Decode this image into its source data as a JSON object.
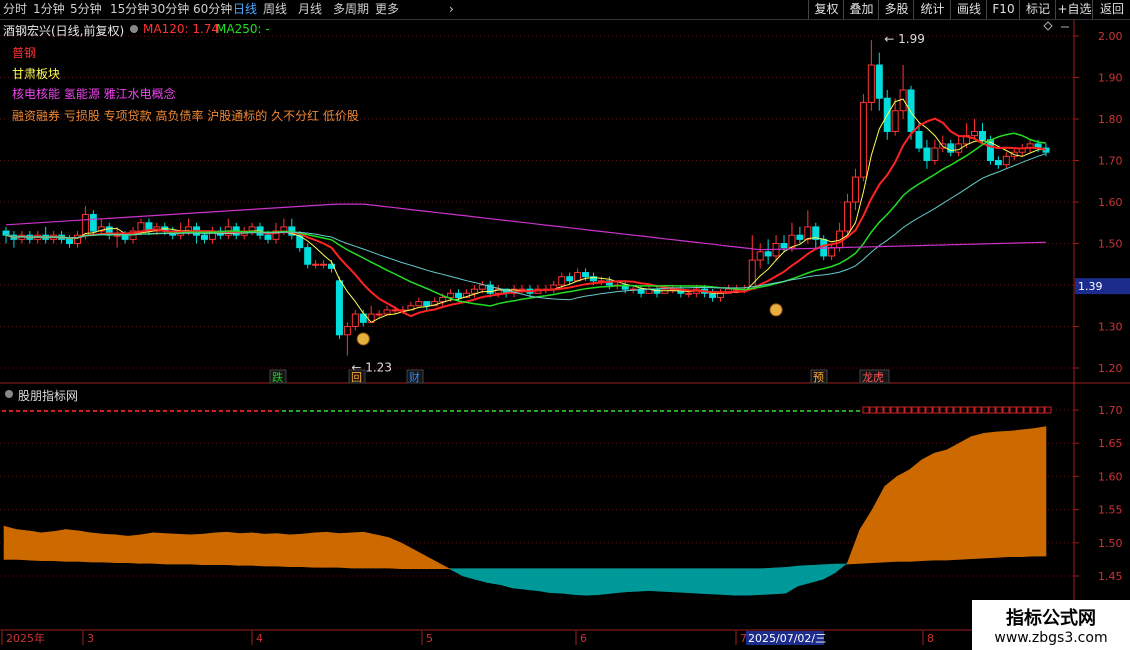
{
  "toolbar": {
    "periods": [
      "分时",
      "1分钟",
      "5分钟",
      "15分钟",
      "30分钟",
      "60分钟",
      "日线",
      "周线",
      "月线",
      "多周期",
      "更多"
    ],
    "active_period": "日线",
    "right_buttons": [
      "复权",
      "叠加",
      "多股",
      "统计",
      "画线",
      "F10",
      "标记",
      "+自选",
      "返回"
    ]
  },
  "stock_header": {
    "name": "酒钢宏兴(日线,前复权)",
    "ma120_label": "MA120: 1.74",
    "ma250_label": "MA250: -"
  },
  "tags": {
    "line1": "普钢",
    "line2": "甘肃板块",
    "line3": "核电核能 氢能源 雅江水电概念",
    "line4": "融资融券 亏损股 专项贷款 高负债率 沪股通标的 久不分红 低价股"
  },
  "price_axis": {
    "ticks": [
      "2.00",
      "1.90",
      "1.80",
      "1.70",
      "1.60",
      "1.50",
      "1.40",
      "1.30",
      "1.20"
    ],
    "current_price": "1.39"
  },
  "indicator_axis": {
    "ticks": [
      "1.70",
      "1.65",
      "1.60",
      "1.55",
      "1.50",
      "1.45"
    ]
  },
  "annotations": {
    "high_label": "1.99",
    "low_label": "1.23",
    "markers": [
      "跌",
      "回",
      "财",
      "预",
      "龙虎"
    ]
  },
  "indicator_title": "股朋指标网",
  "date_axis": {
    "labels": [
      "2025年",
      "3",
      "4",
      "5",
      "6",
      "7",
      "8"
    ],
    "cursor_date": "2025/07/02/三"
  },
  "watermark": {
    "title": "指标公式网",
    "url": "www.zbgs3.com"
  },
  "colors": {
    "up": "#ff3333",
    "down": "#00dddd",
    "ma_yellow": "#ffff55",
    "ma_red": "#ff2222",
    "ma_green": "#22dd22",
    "ma_cyan": "#66cccc",
    "ma_magenta": "#cc33cc",
    "ind_orange": "#cc6a00",
    "ind_teal": "#009999"
  },
  "chart_data": [
    {
      "type": "candlestick",
      "title": "酒钢宏兴(日线,前复权)",
      "ylim": [
        1.18,
        2.02
      ],
      "candles": [
        [
          1.53,
          1.52,
          1.54,
          1.5
        ],
        [
          1.52,
          1.51,
          1.53,
          1.49
        ],
        [
          1.51,
          1.52,
          1.53,
          1.5
        ],
        [
          1.52,
          1.51,
          1.53,
          1.5
        ],
        [
          1.51,
          1.52,
          1.53,
          1.5
        ],
        [
          1.52,
          1.51,
          1.54,
          1.5
        ],
        [
          1.51,
          1.52,
          1.53,
          1.5
        ],
        [
          1.52,
          1.51,
          1.53,
          1.5
        ],
        [
          1.51,
          1.5,
          1.52,
          1.49
        ],
        [
          1.5,
          1.52,
          1.53,
          1.49
        ],
        [
          1.52,
          1.57,
          1.59,
          1.51
        ],
        [
          1.57,
          1.53,
          1.58,
          1.52
        ],
        [
          1.53,
          1.54,
          1.56,
          1.52
        ],
        [
          1.54,
          1.52,
          1.55,
          1.51
        ],
        [
          1.52,
          1.52,
          1.54,
          1.49
        ],
        [
          1.52,
          1.51,
          1.53,
          1.5
        ],
        [
          1.51,
          1.53,
          1.54,
          1.5
        ],
        [
          1.53,
          1.55,
          1.56,
          1.52
        ],
        [
          1.55,
          1.53,
          1.56,
          1.52
        ],
        [
          1.53,
          1.54,
          1.55,
          1.52
        ],
        [
          1.54,
          1.53,
          1.55,
          1.52
        ],
        [
          1.53,
          1.52,
          1.54,
          1.51
        ],
        [
          1.52,
          1.53,
          1.55,
          1.51
        ],
        [
          1.53,
          1.54,
          1.56,
          1.52
        ],
        [
          1.54,
          1.52,
          1.55,
          1.5
        ],
        [
          1.52,
          1.51,
          1.53,
          1.5
        ],
        [
          1.51,
          1.53,
          1.54,
          1.5
        ],
        [
          1.53,
          1.52,
          1.54,
          1.51
        ],
        [
          1.52,
          1.54,
          1.56,
          1.51
        ],
        [
          1.54,
          1.52,
          1.55,
          1.51
        ],
        [
          1.52,
          1.53,
          1.54,
          1.51
        ],
        [
          1.53,
          1.54,
          1.55,
          1.52
        ],
        [
          1.54,
          1.52,
          1.55,
          1.51
        ],
        [
          1.52,
          1.51,
          1.53,
          1.5
        ],
        [
          1.51,
          1.53,
          1.55,
          1.5
        ],
        [
          1.53,
          1.54,
          1.56,
          1.52
        ],
        [
          1.54,
          1.52,
          1.56,
          1.51
        ],
        [
          1.52,
          1.49,
          1.53,
          1.48
        ],
        [
          1.49,
          1.45,
          1.5,
          1.44
        ],
        [
          1.45,
          1.45,
          1.46,
          1.44
        ],
        [
          1.45,
          1.45,
          1.46,
          1.44
        ],
        [
          1.45,
          1.44,
          1.46,
          1.43
        ],
        [
          1.41,
          1.28,
          1.42,
          1.27
        ],
        [
          1.28,
          1.3,
          1.31,
          1.23
        ],
        [
          1.3,
          1.33,
          1.34,
          1.29
        ],
        [
          1.33,
          1.31,
          1.34,
          1.3
        ],
        [
          1.31,
          1.33,
          1.35,
          1.31
        ],
        [
          1.33,
          1.33,
          1.34,
          1.32
        ],
        [
          1.33,
          1.34,
          1.35,
          1.33
        ],
        [
          1.34,
          1.34,
          1.35,
          1.33
        ],
        [
          1.34,
          1.34,
          1.35,
          1.33
        ],
        [
          1.34,
          1.35,
          1.36,
          1.34
        ],
        [
          1.35,
          1.36,
          1.37,
          1.35
        ],
        [
          1.36,
          1.35,
          1.36,
          1.34
        ],
        [
          1.35,
          1.36,
          1.37,
          1.35
        ],
        [
          1.36,
          1.37,
          1.38,
          1.35
        ],
        [
          1.37,
          1.38,
          1.39,
          1.36
        ],
        [
          1.38,
          1.37,
          1.39,
          1.36
        ],
        [
          1.37,
          1.38,
          1.39,
          1.37
        ],
        [
          1.38,
          1.39,
          1.4,
          1.37
        ],
        [
          1.39,
          1.4,
          1.41,
          1.38
        ],
        [
          1.4,
          1.38,
          1.41,
          1.37
        ],
        [
          1.38,
          1.39,
          1.4,
          1.37
        ],
        [
          1.39,
          1.38,
          1.39,
          1.37
        ],
        [
          1.38,
          1.39,
          1.4,
          1.37
        ],
        [
          1.39,
          1.39,
          1.4,
          1.38
        ],
        [
          1.39,
          1.38,
          1.4,
          1.37
        ],
        [
          1.38,
          1.39,
          1.4,
          1.38
        ],
        [
          1.39,
          1.39,
          1.4,
          1.38
        ],
        [
          1.39,
          1.4,
          1.41,
          1.38
        ],
        [
          1.4,
          1.42,
          1.43,
          1.39
        ],
        [
          1.42,
          1.41,
          1.43,
          1.4
        ],
        [
          1.41,
          1.43,
          1.44,
          1.41
        ],
        [
          1.43,
          1.42,
          1.44,
          1.41
        ],
        [
          1.42,
          1.41,
          1.43,
          1.4
        ],
        [
          1.41,
          1.41,
          1.42,
          1.4
        ],
        [
          1.41,
          1.4,
          1.42,
          1.39
        ],
        [
          1.4,
          1.4,
          1.41,
          1.39
        ],
        [
          1.4,
          1.39,
          1.41,
          1.38
        ],
        [
          1.39,
          1.39,
          1.4,
          1.38
        ],
        [
          1.39,
          1.38,
          1.4,
          1.37
        ],
        [
          1.38,
          1.39,
          1.4,
          1.38
        ],
        [
          1.39,
          1.38,
          1.4,
          1.37
        ],
        [
          1.38,
          1.39,
          1.4,
          1.38
        ],
        [
          1.39,
          1.39,
          1.4,
          1.38
        ],
        [
          1.39,
          1.38,
          1.4,
          1.37
        ],
        [
          1.38,
          1.38,
          1.39,
          1.37
        ],
        [
          1.38,
          1.39,
          1.4,
          1.37
        ],
        [
          1.39,
          1.38,
          1.4,
          1.37
        ],
        [
          1.38,
          1.37,
          1.39,
          1.36
        ],
        [
          1.37,
          1.38,
          1.39,
          1.36
        ],
        [
          1.38,
          1.39,
          1.4,
          1.38
        ],
        [
          1.39,
          1.39,
          1.4,
          1.38
        ],
        [
          1.39,
          1.39,
          1.4,
          1.38
        ],
        [
          1.39,
          1.46,
          1.52,
          1.39
        ],
        [
          1.46,
          1.48,
          1.5,
          1.44
        ],
        [
          1.48,
          1.47,
          1.51,
          1.45
        ],
        [
          1.47,
          1.5,
          1.52,
          1.46
        ],
        [
          1.5,
          1.49,
          1.52,
          1.48
        ],
        [
          1.49,
          1.52,
          1.55,
          1.48
        ],
        [
          1.52,
          1.51,
          1.54,
          1.5
        ],
        [
          1.51,
          1.54,
          1.58,
          1.5
        ],
        [
          1.54,
          1.51,
          1.55,
          1.49
        ],
        [
          1.51,
          1.47,
          1.52,
          1.46
        ],
        [
          1.47,
          1.49,
          1.5,
          1.46
        ],
        [
          1.49,
          1.53,
          1.55,
          1.48
        ],
        [
          1.53,
          1.6,
          1.62,
          1.52
        ],
        [
          1.6,
          1.66,
          1.68,
          1.58
        ],
        [
          1.66,
          1.84,
          1.86,
          1.65
        ],
        [
          1.84,
          1.93,
          1.99,
          1.82
        ],
        [
          1.93,
          1.85,
          1.96,
          1.82
        ],
        [
          1.85,
          1.77,
          1.87,
          1.75
        ],
        [
          1.77,
          1.82,
          1.85,
          1.76
        ],
        [
          1.82,
          1.87,
          1.93,
          1.8
        ],
        [
          1.87,
          1.77,
          1.88,
          1.75
        ],
        [
          1.77,
          1.73,
          1.79,
          1.72
        ],
        [
          1.73,
          1.7,
          1.75,
          1.68
        ],
        [
          1.7,
          1.73,
          1.75,
          1.69
        ],
        [
          1.73,
          1.74,
          1.76,
          1.72
        ],
        [
          1.74,
          1.72,
          1.75,
          1.71
        ],
        [
          1.72,
          1.74,
          1.76,
          1.71
        ],
        [
          1.74,
          1.76,
          1.79,
          1.73
        ],
        [
          1.76,
          1.77,
          1.8,
          1.75
        ],
        [
          1.77,
          1.75,
          1.79,
          1.74
        ],
        [
          1.75,
          1.7,
          1.76,
          1.69
        ],
        [
          1.7,
          1.69,
          1.71,
          1.68
        ],
        [
          1.69,
          1.71,
          1.72,
          1.68
        ],
        [
          1.71,
          1.72,
          1.73,
          1.7
        ],
        [
          1.72,
          1.73,
          1.74,
          1.71
        ],
        [
          1.73,
          1.74,
          1.75,
          1.72
        ],
        [
          1.74,
          1.73,
          1.75,
          1.72
        ],
        [
          1.73,
          1.72,
          1.74,
          1.71
        ]
      ],
      "ma": [
        {
          "name": "MA120",
          "value": "1.74"
        },
        {
          "name": "MA250",
          "value": "-"
        }
      ]
    },
    {
      "type": "area",
      "title": "股朋指标网",
      "ylim": [
        1.4,
        1.72
      ],
      "values": [
        1.525,
        1.52,
        1.518,
        1.515,
        1.517,
        1.52,
        1.518,
        1.515,
        1.513,
        1.512,
        1.51,
        1.512,
        1.515,
        1.514,
        1.513,
        1.512,
        1.513,
        1.515,
        1.516,
        1.514,
        1.515,
        1.513,
        1.514,
        1.512,
        1.513,
        1.515,
        1.516,
        1.514,
        1.515,
        1.516,
        1.512,
        1.508,
        1.5,
        1.49,
        1.48,
        1.47,
        1.46,
        1.45,
        1.445,
        1.44,
        1.437,
        1.432,
        1.43,
        1.428,
        1.425,
        1.424,
        1.422,
        1.421,
        1.422,
        1.424,
        1.426,
        1.427,
        1.428,
        1.427,
        1.426,
        1.425,
        1.424,
        1.423,
        1.422,
        1.421,
        1.421,
        1.422,
        1.423,
        1.424,
        1.435,
        1.44,
        1.445,
        1.455,
        1.47,
        1.52,
        1.55,
        1.585,
        1.6,
        1.61,
        1.625,
        1.635,
        1.64,
        1.65,
        1.66,
        1.665,
        1.667,
        1.668,
        1.67,
        1.672,
        1.675
      ],
      "baseline": [
        1.475,
        1.475,
        1.474,
        1.473,
        1.473,
        1.472,
        1.472,
        1.471,
        1.471,
        1.47,
        1.47,
        1.469,
        1.469,
        1.468,
        1.468,
        1.468,
        1.467,
        1.467,
        1.467,
        1.466,
        1.466,
        1.465,
        1.465,
        1.464,
        1.464,
        1.463,
        1.463,
        1.463,
        1.462,
        1.462,
        1.462,
        1.462,
        1.461,
        1.461,
        1.461,
        1.461,
        1.461,
        1.461,
        1.461,
        1.461,
        1.461,
        1.461,
        1.461,
        1.461,
        1.461,
        1.461,
        1.461,
        1.461,
        1.461,
        1.461,
        1.461,
        1.461,
        1.461,
        1.461,
        1.461,
        1.461,
        1.461,
        1.461,
        1.461,
        1.461,
        1.461,
        1.461,
        1.462,
        1.463,
        1.465,
        1.466,
        1.467,
        1.468,
        1.468,
        1.469,
        1.47,
        1.471,
        1.472,
        1.472,
        1.473,
        1.474,
        1.474,
        1.475,
        1.476,
        1.477,
        1.478,
        1.479,
        1.479,
        1.48,
        1.48
      ]
    }
  ]
}
